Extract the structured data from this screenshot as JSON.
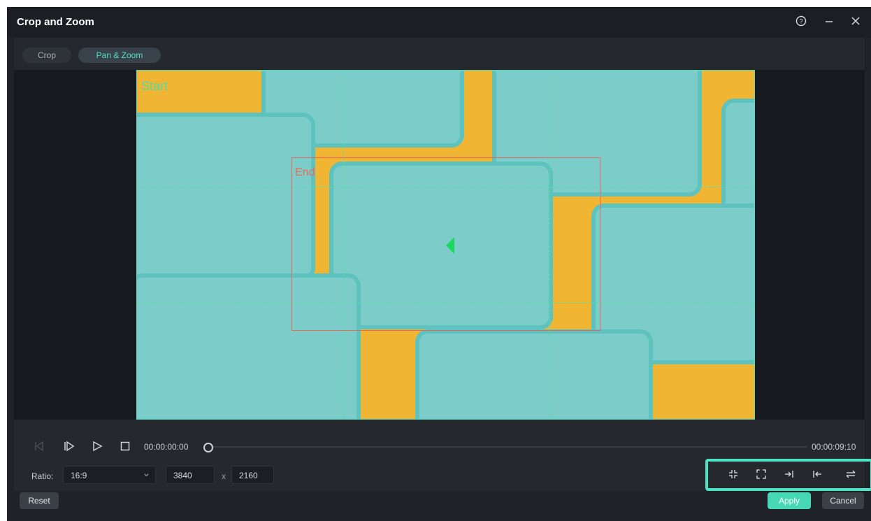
{
  "window": {
    "title": "Crop and Zoom",
    "help_icon": "help-circle-icon",
    "minimize_icon": "minimize-icon",
    "close_icon": "close-icon"
  },
  "tabs": [
    {
      "label": "Crop",
      "active": false
    },
    {
      "label": "Pan & Zoom",
      "active": true
    }
  ],
  "preview": {
    "start_label": "Start",
    "end_label": "End",
    "colors": {
      "start": "#53dba8",
      "end": "#f06a58",
      "accent": "#4de3c4"
    }
  },
  "playback": {
    "current_time": "00:00:00:00",
    "total_time": "00:00:09:10",
    "progress": 0,
    "icons": [
      "prev-frame-icon",
      "next-frame-icon",
      "play-icon",
      "stop-icon"
    ]
  },
  "ratio": {
    "label": "Ratio:",
    "value": "16:9",
    "width": "3840",
    "separator": "x",
    "height": "2160"
  },
  "transform_tools": [
    "shrink-icon",
    "expand-icon",
    "move-to-end-icon",
    "move-to-start-icon",
    "swap-icon"
  ],
  "footer": {
    "reset": "Reset",
    "apply": "Apply",
    "cancel": "Cancel"
  }
}
